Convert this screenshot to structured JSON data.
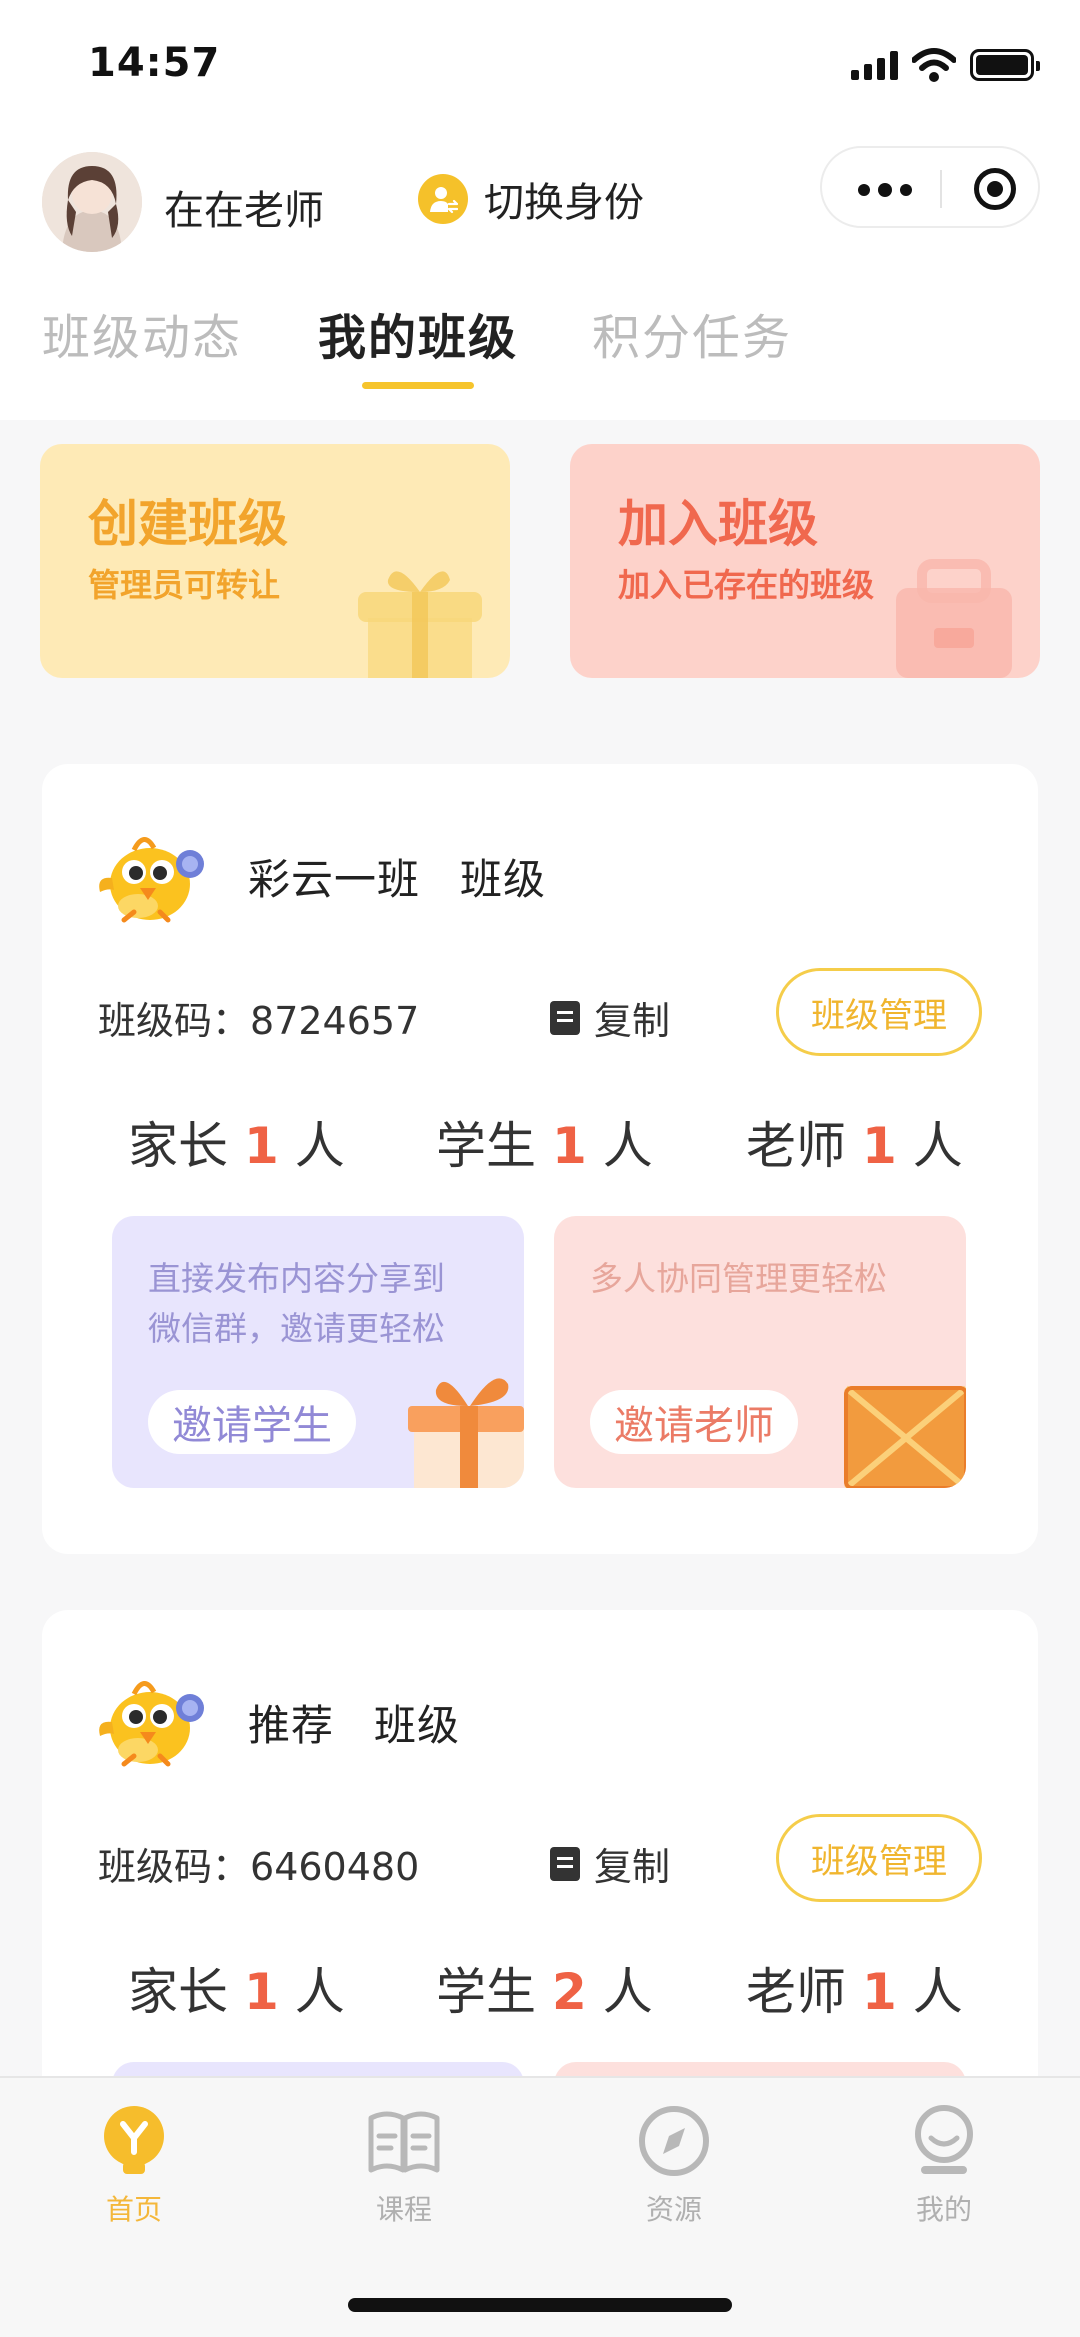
{
  "status_bar": {
    "time": "14:57"
  },
  "header": {
    "teacher_name": "在在老师",
    "switch_label": "切换身份"
  },
  "tabs": [
    {
      "label": "班级动态",
      "active": false
    },
    {
      "label": "我的班级",
      "active": true
    },
    {
      "label": "积分任务",
      "active": false
    }
  ],
  "actions": {
    "create": {
      "title": "创建班级",
      "subtitle": "管理员可转让"
    },
    "join": {
      "title": "加入班级",
      "subtitle": "加入已存在的班级"
    }
  },
  "classes": [
    {
      "name": "彩云一班",
      "suffix": "班级",
      "code_label": "班级码：",
      "code": "8724657",
      "copy_label": "复制",
      "manage_label": "班级管理",
      "counts": [
        {
          "label": "家长",
          "value": "1",
          "unit": "人"
        },
        {
          "label": "学生",
          "value": "1",
          "unit": "人"
        },
        {
          "label": "老师",
          "value": "1",
          "unit": "人"
        }
      ],
      "promos": [
        {
          "text": "直接发布内容分享到微信群，邀请更轻松",
          "button": "邀请学生"
        },
        {
          "text": "多人协同管理更轻松",
          "button": "邀请老师"
        }
      ]
    },
    {
      "name": "推荐",
      "suffix": "班级",
      "code_label": "班级码：",
      "code": "6460480",
      "copy_label": "复制",
      "manage_label": "班级管理",
      "counts": [
        {
          "label": "家长",
          "value": "1",
          "unit": "人"
        },
        {
          "label": "学生",
          "value": "2",
          "unit": "人"
        },
        {
          "label": "老师",
          "value": "1",
          "unit": "人"
        }
      ]
    }
  ],
  "tabbar": [
    {
      "label": "首页",
      "icon": "home-bulb-icon",
      "active": true
    },
    {
      "label": "课程",
      "icon": "book-icon",
      "active": false
    },
    {
      "label": "资源",
      "icon": "compass-icon",
      "active": false
    },
    {
      "label": "我的",
      "icon": "profile-icon",
      "active": false
    }
  ],
  "colors": {
    "accent_yellow": "#f6c42c",
    "count_red": "#ef6245",
    "create_bg": "#feeab6",
    "join_bg": "#fdd2ca"
  }
}
